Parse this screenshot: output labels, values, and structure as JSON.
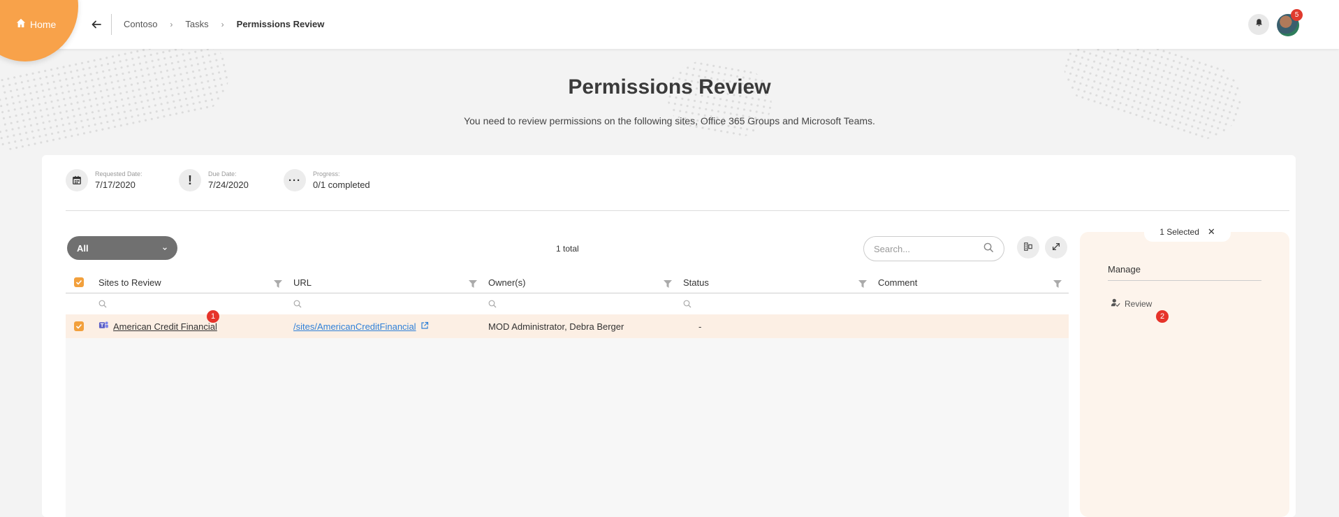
{
  "topbar": {
    "home_label": "Home",
    "breadcrumb": [
      "Contoso",
      "Tasks",
      "Permissions Review"
    ],
    "notification_count": "5"
  },
  "header": {
    "title": "Permissions Review",
    "subtitle": "You need to review permissions on the following sites, Office 365 Groups and Microsoft Teams."
  },
  "meta": {
    "requested_label": "Requested Date:",
    "requested_value": "7/17/2020",
    "due_label": "Due Date:",
    "due_value": "7/24/2020",
    "progress_label": "Progress:",
    "progress_value": "0/1 completed"
  },
  "toolbar": {
    "filter_value": "All",
    "total": "1 total",
    "search_placeholder": "Search..."
  },
  "table": {
    "columns": [
      "Sites to Review",
      "URL",
      "Owner(s)",
      "Status",
      "Comment"
    ],
    "rows": [
      {
        "site": "American Credit Financial",
        "url": "/sites/AmericanCreditFinancial",
        "owners": "MOD Administrator, Debra Berger",
        "status": "-",
        "comment": ""
      }
    ]
  },
  "panel": {
    "selected": "1 Selected",
    "manage_title": "Manage",
    "review_action": "Review"
  },
  "callouts": [
    "1",
    "2"
  ],
  "colors": {
    "accent": "#f8a24a",
    "selected_row": "#fcefe4",
    "link": "#2f80d8",
    "badge": "#e6332a"
  }
}
